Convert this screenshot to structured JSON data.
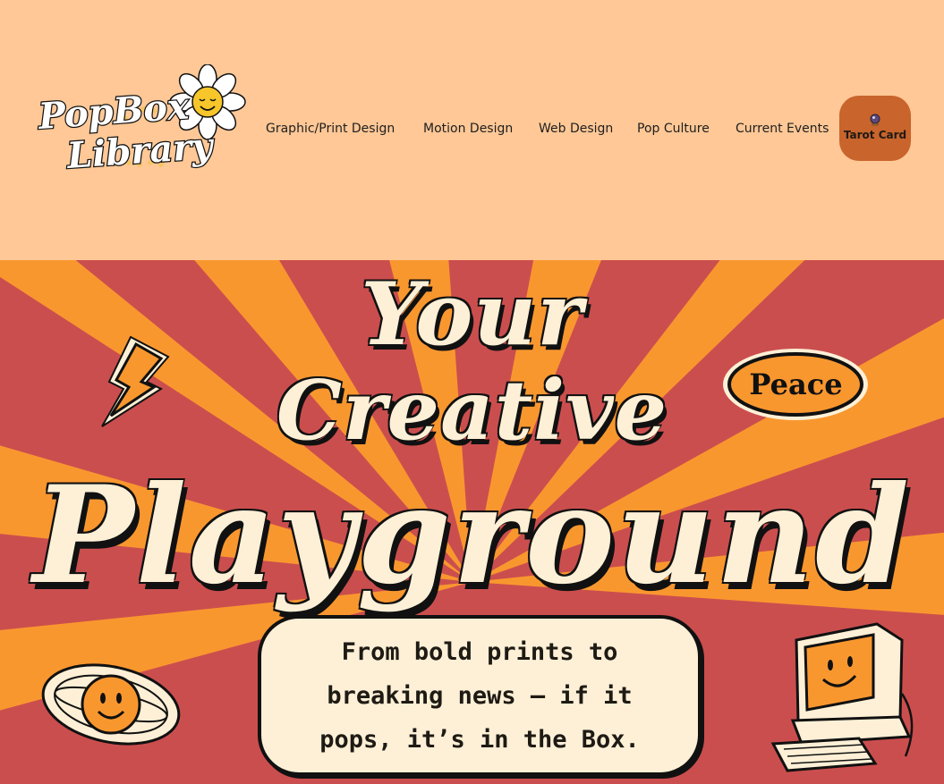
{
  "header": {
    "logo": {
      "line1": "PopBox",
      "line2": "Library"
    },
    "nav": [
      {
        "label": "Graphic/Print Design"
      },
      {
        "label": "Motion Design"
      },
      {
        "label": "Web Design"
      },
      {
        "label": "Pop Culture"
      },
      {
        "label": "Current Events"
      }
    ],
    "tarot_button": {
      "label": "Tarot Card",
      "icon": "crystal-ball-icon"
    }
  },
  "hero": {
    "line1": "Your",
    "line2": "Creative",
    "line3": "Playground",
    "tagline": "From bold prints to breaking news — if it pops, it’s in the Box.",
    "stickers": {
      "peace": "Peace",
      "lightning": "lightning-bolt-icon",
      "planet": "smiley-planet-icon",
      "computer": "smiley-computer-icon"
    }
  },
  "colors": {
    "header_bg": "#ffc896",
    "hero_red": "#cb4e4e",
    "hero_orange": "#f9972f",
    "cream": "#fdf0d6",
    "button_orange": "#c8642c"
  }
}
